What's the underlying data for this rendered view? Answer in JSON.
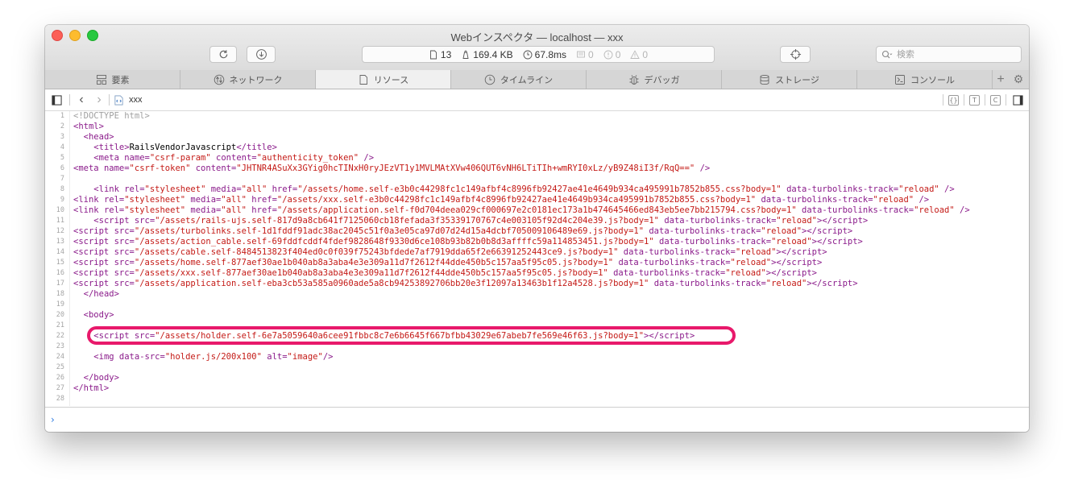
{
  "window": {
    "title": "Webインスペクタ — localhost — xxx"
  },
  "toolbar": {
    "stats": {
      "resources": "13",
      "size": "169.4 KB",
      "time": "67.8ms",
      "logs": "0",
      "errors": "0",
      "warnings": "0"
    },
    "search_placeholder": "検索"
  },
  "tabs": [
    {
      "label": "要素",
      "icon": "elements-icon"
    },
    {
      "label": "ネットワーク",
      "icon": "network-icon"
    },
    {
      "label": "リソース",
      "icon": "resources-icon"
    },
    {
      "label": "タイムライン",
      "icon": "timeline-icon"
    },
    {
      "label": "デバッガ",
      "icon": "debugger-icon"
    },
    {
      "label": "ストレージ",
      "icon": "storage-icon"
    },
    {
      "label": "コンソール",
      "icon": "console-icon"
    }
  ],
  "active_tab": "リソース",
  "navbar": {
    "resource_name": "xxx"
  },
  "code_lines": [
    {
      "n": "1",
      "html": "<span class='cm'>&lt;!DOCTYPE html&gt;</span>"
    },
    {
      "n": "2",
      "html": "<span class='t'>&lt;html&gt;</span>"
    },
    {
      "n": "3",
      "html": "  <span class='t'>&lt;head&gt;</span>"
    },
    {
      "n": "4",
      "html": "    <span class='t'>&lt;title&gt;</span><span class='tx'>RailsVendorJavascript</span><span class='t'>&lt;/title&gt;</span>"
    },
    {
      "n": "5",
      "html": "    <span class='t'>&lt;meta </span><span class='a'>name=</span><span class='v'>\"csrf-param\"</span> <span class='a'>content=</span><span class='v'>\"authenticity_token\"</span><span class='t'> /&gt;</span>"
    },
    {
      "n": "6",
      "html": "<span class='t'>&lt;meta </span><span class='a'>name=</span><span class='v'>\"csrf-token\"</span> <span class='a'>content=</span><span class='v'>\"JHTNR4ASuXx3GYig0hcTINxH0ryJEzVT1y1MVLMAtXVw406QUT6vNH6LTiTIh+wmRYI0xLz/yB9Z48iI3f/RqQ==\"</span><span class='t'> /&gt;</span>"
    },
    {
      "n": "7",
      "html": ""
    },
    {
      "n": "8",
      "html": "    <span class='t'>&lt;link </span><span class='a'>rel=</span><span class='v'>\"stylesheet\"</span> <span class='a'>media=</span><span class='v'>\"all\"</span> <span class='a'>href=</span><span class='v'>\"/assets/home.self-e3b0c44298fc1c149afbf4c8996fb92427ae41e4649b934ca495991b7852b855.css?body=1\"</span> <span class='a'>data-turbolinks-track=</span><span class='v'>\"reload\"</span><span class='t'> /&gt;</span>"
    },
    {
      "n": "9",
      "html": "<span class='t'>&lt;link </span><span class='a'>rel=</span><span class='v'>\"stylesheet\"</span> <span class='a'>media=</span><span class='v'>\"all\"</span> <span class='a'>href=</span><span class='v'>\"/assets/xxx.self-e3b0c44298fc1c149afbf4c8996fb92427ae41e4649b934ca495991b7852b855.css?body=1\"</span> <span class='a'>data-turbolinks-track=</span><span class='v'>\"reload\"</span><span class='t'> /&gt;</span>"
    },
    {
      "n": "10",
      "html": "<span class='t'>&lt;link </span><span class='a'>rel=</span><span class='v'>\"stylesheet\"</span> <span class='a'>media=</span><span class='v'>\"all\"</span> <span class='a'>href=</span><span class='v'>\"/assets/application.self-f0d704deea029cf000697e2c0181ec173a1b474645466ed843eb5ee7bb215794.css?body=1\"</span> <span class='a'>data-turbolinks-track=</span><span class='v'>\"reload\"</span><span class='t'> /&gt;</span>"
    },
    {
      "n": "11",
      "html": "    <span class='t'>&lt;script </span><span class='a'>src=</span><span class='v'>\"/assets/rails-ujs.self-817d9a8cb641f7125060cb18fefada3f35339170767c4e003105f92d4c204e39.js?body=1\"</span> <span class='a'>data-turbolinks-track=</span><span class='v'>\"reload\"</span><span class='t'>&gt;&lt;/script&gt;</span>"
    },
    {
      "n": "12",
      "html": "<span class='t'>&lt;script </span><span class='a'>src=</span><span class='v'>\"/assets/turbolinks.self-1d1fddf91adc38ac2045c51f0a3e05ca97d07d24d15a4dcbf705009106489e69.js?body=1\"</span> <span class='a'>data-turbolinks-track=</span><span class='v'>\"reload\"</span><span class='t'>&gt;&lt;/script&gt;</span>"
    },
    {
      "n": "13",
      "html": "<span class='t'>&lt;script </span><span class='a'>src=</span><span class='v'>\"/assets/action_cable.self-69fddfcddf4fdef9828648f9330d6ce108b93b82b0b8d3affffc59a114853451.js?body=1\"</span> <span class='a'>data-turbolinks-track=</span><span class='v'>\"reload\"</span><span class='t'>&gt;&lt;/script&gt;</span>"
    },
    {
      "n": "14",
      "html": "<span class='t'>&lt;script </span><span class='a'>src=</span><span class='v'>\"/assets/cable.self-8484513823f404ed0c0f039f75243bfdede7af7919dda65f2e66391252443ce9.js?body=1\"</span> <span class='a'>data-turbolinks-track=</span><span class='v'>\"reload\"</span><span class='t'>&gt;&lt;/script&gt;</span>"
    },
    {
      "n": "15",
      "html": "<span class='t'>&lt;script </span><span class='a'>src=</span><span class='v'>\"/assets/home.self-877aef30ae1b040ab8a3aba4e3e309a11d7f2612f44dde450b5c157aa5f95c05.js?body=1\"</span> <span class='a'>data-turbolinks-track=</span><span class='v'>\"reload\"</span><span class='t'>&gt;&lt;/script&gt;</span>"
    },
    {
      "n": "16",
      "html": "<span class='t'>&lt;script </span><span class='a'>src=</span><span class='v'>\"/assets/xxx.self-877aef30ae1b040ab8a3aba4e3e309a11d7f2612f44dde450b5c157aa5f95c05.js?body=1\"</span> <span class='a'>data-turbolinks-track=</span><span class='v'>\"reload\"</span><span class='t'>&gt;&lt;/script&gt;</span>"
    },
    {
      "n": "17",
      "html": "<span class='t'>&lt;script </span><span class='a'>src=</span><span class='v'>\"/assets/application.self-eba3cb53a585a0960ade5a8cb94253892706bb20e3f12097a13463b1f12a4528.js?body=1\"</span> <span class='a'>data-turbolinks-track=</span><span class='v'>\"reload\"</span><span class='t'>&gt;&lt;/script&gt;</span>"
    },
    {
      "n": "18",
      "html": "  <span class='t'>&lt;/head&gt;</span>"
    },
    {
      "n": "19",
      "html": ""
    },
    {
      "n": "20",
      "html": "  <span class='t'>&lt;body&gt;</span>"
    },
    {
      "n": "21",
      "html": ""
    },
    {
      "n": "22",
      "html": "    <span class='t'>&lt;script </span><span class='a'>src=</span><span class='v'>\"/assets/holder.self-6e7a5059640a6cee91fbbc8c7e6b6645f667bfbb43029e67abeb7fe569e46f63.js?body=1\"</span><span class='t'>&gt;&lt;/script&gt;</span>"
    },
    {
      "n": "23",
      "html": ""
    },
    {
      "n": "24",
      "html": "    <span class='t'>&lt;img </span><span class='a'>data-src=</span><span class='v'>\"holder.js/200x100\"</span> <span class='a'>alt=</span><span class='v'>\"image\"</span><span class='t'>/&gt;</span>"
    },
    {
      "n": "25",
      "html": ""
    },
    {
      "n": "26",
      "html": "  <span class='t'>&lt;/body&gt;</span>"
    },
    {
      "n": "27",
      "html": "<span class='t'>&lt;/html&gt;</span>"
    },
    {
      "n": "28",
      "html": ""
    }
  ],
  "colors": {
    "highlight": "#e8196b",
    "tag": "#8a1a8a",
    "string": "#c41a16",
    "prompt": "#2f7de1"
  }
}
